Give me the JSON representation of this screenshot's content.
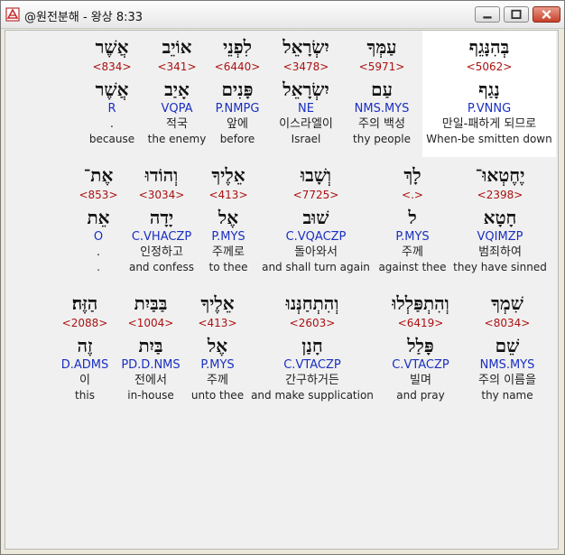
{
  "window": {
    "title": "@원전분해 - 왕상 8:33",
    "colors": {
      "titlebar": "#ececec",
      "content_bg": "#f0f0f0",
      "highlight": "#ffffff",
      "strong_num": "#a11111",
      "morph": "#1a2fc0"
    },
    "icons": {
      "app": "app-logo-icon",
      "minimize": "minimize-icon",
      "maximize": "maximize-icon",
      "close": "close-icon"
    }
  },
  "rows": [
    {
      "words": [
        {
          "heb": "אֲשֶׁר",
          "num": "<834>",
          "lex": "אֲשֶׁר",
          "morph": "R",
          "kor": ".",
          "eng": "because"
        },
        {
          "heb": "אוֹיֵב",
          "num": "<341>",
          "lex": "אָיַב",
          "morph": "VQPA",
          "kor": "적국",
          "eng": "the enemy"
        },
        {
          "heb": "לִפְנֵי",
          "num": "<6440>",
          "lex": "פָּנִים",
          "morph": "P.NMPG",
          "kor": "앞에",
          "eng": "before"
        },
        {
          "heb": "יִשְׂרָאֵל",
          "num": "<3478>",
          "lex": "יִשְׂרָאֵל",
          "morph": "NE",
          "kor": "이스라엘이",
          "eng": "Israel"
        },
        {
          "heb": "עַמְּךָ",
          "num": "<5971>",
          "lex": "עַם",
          "morph": "NMS.MYS",
          "kor": "주의 백성",
          "eng": "thy people"
        },
        {
          "heb": "בְּהִנָּגֵף",
          "num": "<5062>",
          "lex": "נָגַף",
          "morph": "P.VNNG",
          "kor": "만일-패하게 되므로",
          "eng": "When-be smitten down"
        }
      ]
    },
    {
      "words": [
        {
          "heb": "אֶת־",
          "num": "<853>",
          "lex": "אֵת",
          "morph": "O",
          "kor": ".",
          "eng": "."
        },
        {
          "heb": "וְהוֹדוּ",
          "num": "<3034>",
          "lex": "יָדָה",
          "morph": "C.VHACZP",
          "kor": "인정하고",
          "eng": "and confess"
        },
        {
          "heb": "אֵלֶיךָ",
          "num": "<413>",
          "lex": "אֶל",
          "morph": "P.MYS",
          "kor": "주께로",
          "eng": "to thee"
        },
        {
          "heb": "וְשָׁבוּ",
          "num": "<7725>",
          "lex": "שׁוּב",
          "morph": "C.VQACZP",
          "kor": "돌아와서",
          "eng": "and shall turn again"
        },
        {
          "heb": "לָךְ",
          "num": "<.>",
          "lex": "ל",
          "morph": "P.MYS",
          "kor": "주께",
          "eng": "against thee"
        },
        {
          "heb": "יֶחֶטְאוּ־",
          "num": "<2398>",
          "lex": "חָטָא",
          "morph": "VQIMZP",
          "kor": "범죄하여",
          "eng": "they have sinned"
        }
      ]
    },
    {
      "words": [
        {
          "heb": "הַזֶּה׃",
          "num": "<2088>",
          "lex": "זֶה",
          "morph": "D.ADMS",
          "kor": "이",
          "eng": "this"
        },
        {
          "heb": "בַּבַּיִת",
          "num": "<1004>",
          "lex": "בַּיִת",
          "morph": "PD.D.NMS",
          "kor": "전에서",
          "eng": "in-house"
        },
        {
          "heb": "אֵלֶיךָ",
          "num": "<413>",
          "lex": "אֶל",
          "morph": "P.MYS",
          "kor": "주께",
          "eng": "unto thee"
        },
        {
          "heb": "וְהִתְחַנְּנוּ",
          "num": "<2603>",
          "lex": "חָנַן",
          "morph": "C.VTACZP",
          "kor": "간구하거든",
          "eng": "and make supplication"
        },
        {
          "heb": "וְהִתְפַּלְלוּ",
          "num": "<6419>",
          "lex": "פָּלַל",
          "morph": "C.VTACZP",
          "kor": "빌며",
          "eng": "and pray"
        },
        {
          "heb": "שִׁמְךָ",
          "num": "<8034>",
          "lex": "שֵׁם",
          "morph": "NMS.MYS",
          "kor": "주의 이름을",
          "eng": "thy name"
        }
      ]
    }
  ]
}
